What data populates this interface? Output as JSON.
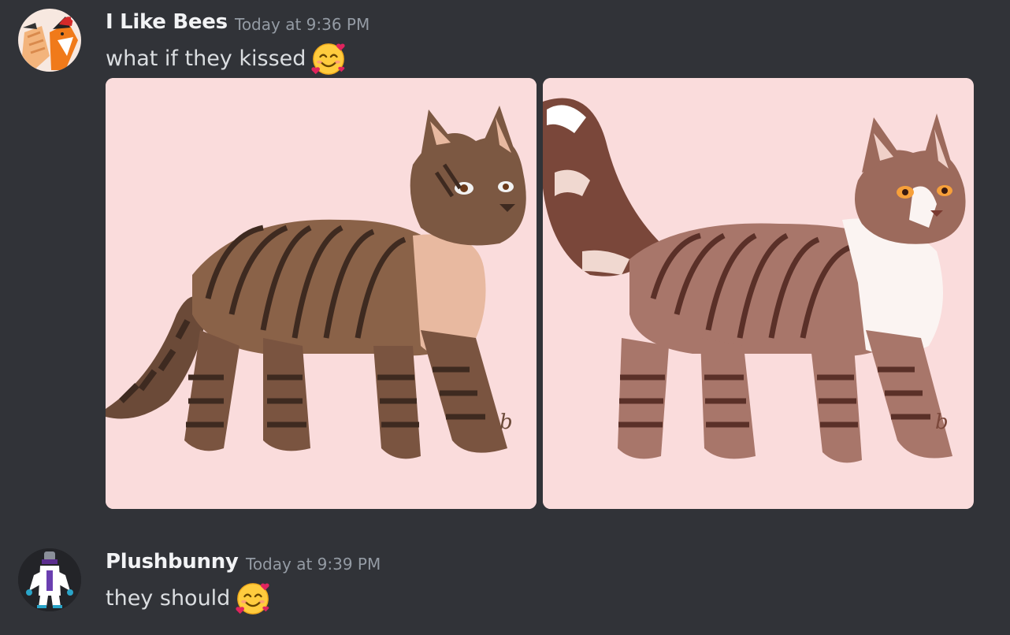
{
  "messages": [
    {
      "username": "I Like Bees",
      "timestamp": "Today at 9:36 PM",
      "text": "what if they kissed",
      "emoji": "smiling-face-with-hearts",
      "attachments": [
        "cat-drawing-dark-tabby",
        "cat-drawing-light-tabby-white-chest"
      ]
    },
    {
      "username": "Plushbunny",
      "timestamp": "Today at 9:39 PM",
      "text": "they should",
      "emoji": "smiling-face-with-hearts"
    }
  ],
  "colors": {
    "background": "#313338",
    "username": "#f2f3f5",
    "timestamp": "#949ba4",
    "text": "#dbdee1",
    "attachment_bg": "#fadcdc"
  }
}
